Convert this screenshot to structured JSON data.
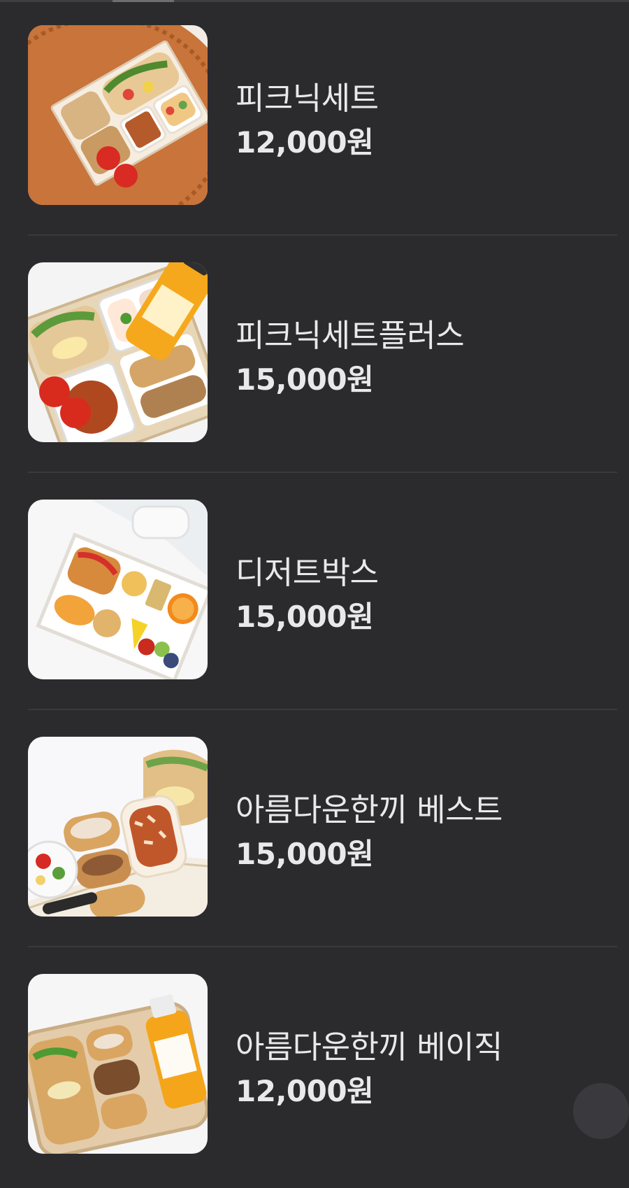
{
  "menu_items": [
    {
      "name": "피크닉세트",
      "price": "12,000원",
      "image": "picnic-set-photo"
    },
    {
      "name": "피크닉세트플러스",
      "price": "15,000원",
      "image": "picnic-set-plus-photo"
    },
    {
      "name": "디저트박스",
      "price": "15,000원",
      "image": "dessert-box-photo"
    },
    {
      "name": "아름다운한끼 베스트",
      "price": "15,000원",
      "image": "beautiful-meal-best-photo"
    },
    {
      "name": "아름다운한끼 베이직",
      "price": "12,000원",
      "image": "beautiful-meal-basic-photo"
    }
  ],
  "colors": {
    "background": "#2b2b2e",
    "text": "#e9e9ea",
    "divider": "#3a3a3e"
  }
}
